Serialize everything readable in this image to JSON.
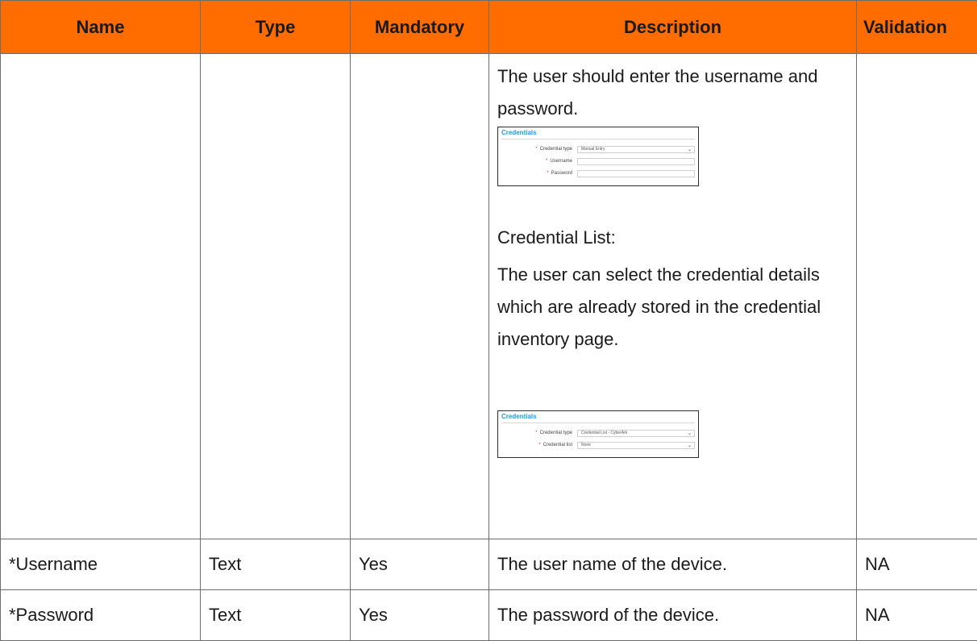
{
  "headers": [
    "Name",
    "Type",
    "Mandatory",
    "Description",
    "Validation"
  ],
  "row_credential": {
    "desc_1": "The user should enter the username and password.",
    "thumb1": {
      "title": "Credentials",
      "fields": [
        {
          "label": "Credential type",
          "value": "Manual Entry",
          "dropdown": true
        },
        {
          "label": "Username",
          "value": "",
          "dropdown": false
        },
        {
          "label": "Password",
          "value": "",
          "dropdown": false
        }
      ]
    },
    "desc_2": "Credential List:",
    "desc_3": "The user can select the credential details which are already stored in the credential inventory page.",
    "thumb2": {
      "title": "Credentials",
      "fields": [
        {
          "label": "Credential type",
          "value": "Credential List - CyberArk",
          "dropdown": true
        },
        {
          "label": "Credential list",
          "value": "None",
          "dropdown": true
        }
      ]
    }
  },
  "rows": [
    {
      "name": "*Username",
      "type": "Text",
      "mandatory": "Yes",
      "description": "The user name of the device.",
      "validation": "NA"
    },
    {
      "name": "*Password",
      "type": "Text",
      "mandatory": "Yes",
      "description": "The password of the device.",
      "validation": "NA"
    }
  ],
  "colors": {
    "header_bg": "#ff6c00",
    "thumb_title": "#1f9bd6",
    "required_mark": "#d33333"
  }
}
